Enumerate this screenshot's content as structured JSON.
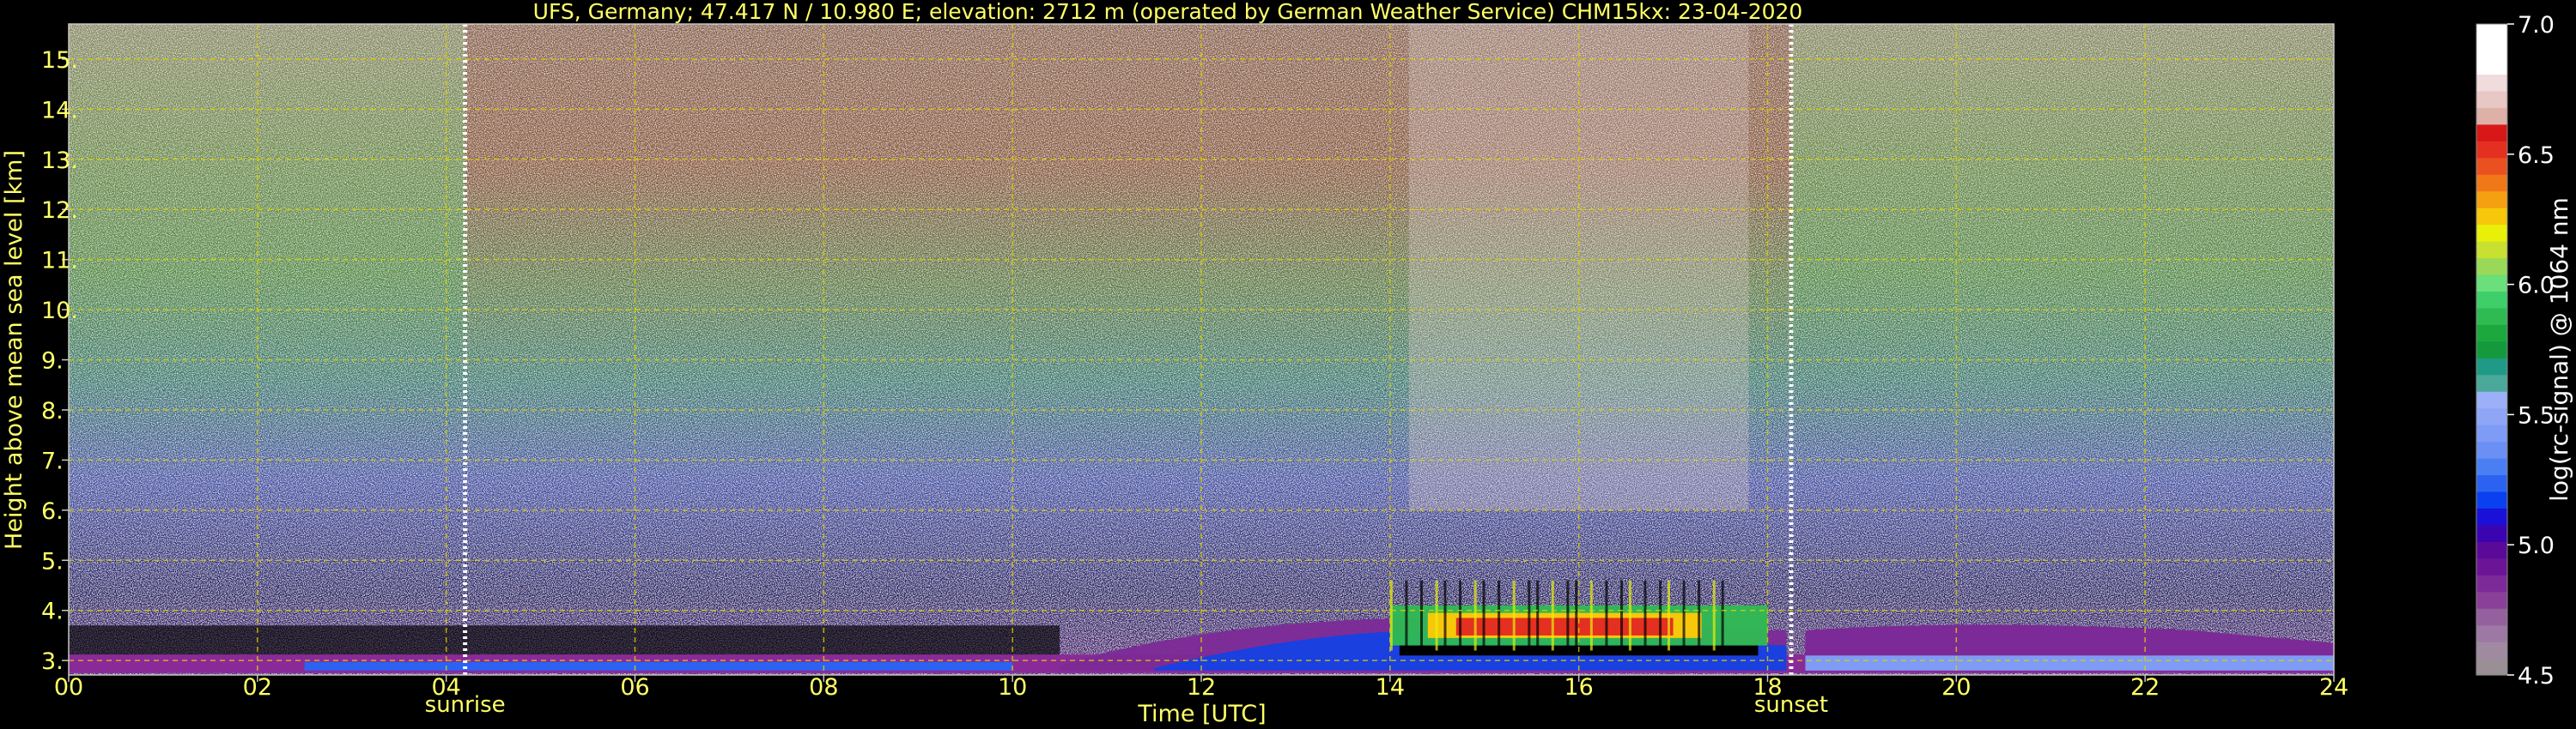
{
  "chart_data": {
    "type": "heatmap",
    "title": "UFS, Germany; 47.417 N / 10.980 E; elevation: 2712 m  (operated by German Weather Service)    CHM15kx: 23-04-2020",
    "xlabel": "Time [UTC]",
    "ylabel": "Height above mean sea level [km]",
    "xlim": [
      0,
      24
    ],
    "ylim": [
      2.712,
      15.7
    ],
    "x_ticks": [
      "00",
      "02",
      "04",
      "06",
      "08",
      "10",
      "12",
      "14",
      "16",
      "18",
      "20",
      "22",
      "24"
    ],
    "x_tick_values": [
      0,
      2,
      4,
      6,
      8,
      10,
      12,
      14,
      16,
      18,
      20,
      22,
      24
    ],
    "y_ticks": [
      "3.",
      "4.",
      "5.",
      "6.",
      "7.",
      "8.",
      "9.",
      "10.",
      "11.",
      "12.",
      "13.",
      "14.",
      "15."
    ],
    "y_tick_values": [
      3,
      4,
      5,
      6,
      7,
      8,
      9,
      10,
      11,
      12,
      13,
      14,
      15
    ],
    "grid": true,
    "markers": [
      {
        "label": "sunrise",
        "x": 4.2
      },
      {
        "label": "sunset",
        "x": 18.25
      }
    ],
    "colorbar": {
      "label": "log(rc-signal) @ 1064 nm",
      "range": [
        4.5,
        7.0
      ],
      "ticks": [
        "4.5",
        "5.0",
        "5.5",
        "6.0",
        "6.5",
        "7.0"
      ],
      "tick_values": [
        4.5,
        5.0,
        5.5,
        6.0,
        6.5,
        7.0
      ],
      "colors": [
        "#9a8f95",
        "#a08aa2",
        "#9d78a5",
        "#94609e",
        "#8a3f98",
        "#7c2a97",
        "#6c1496",
        "#5a0a98",
        "#3a04b0",
        "#1a10d8",
        "#0a40f0",
        "#2b62f2",
        "#4a7ff3",
        "#6a90f4",
        "#7e9cf6",
        "#8fa6f7",
        "#9bb0f8",
        "#4aa89a",
        "#1f9a86",
        "#149a3c",
        "#1da83e",
        "#2fbb52",
        "#3fcf6a",
        "#6adf7a",
        "#9ad958",
        "#c8e030",
        "#e8f00a",
        "#f7c80a",
        "#f5a010",
        "#f07818",
        "#eb5020",
        "#e43020",
        "#d81818",
        "#ddb0a8",
        "#e8c8c4",
        "#f0dcdc",
        "#ffffff",
        "#ffffff",
        "#ffffff"
      ]
    },
    "background_field": {
      "description_levels_km": [
        3,
        4,
        6,
        8,
        10,
        12,
        15.7
      ],
      "day_colors": [
        "#3a1a66",
        "#2a1a6a",
        "#3f4fa6",
        "#2f7a70",
        "#4f8a3a",
        "#8a5a30",
        "#8a6040"
      ],
      "night_colors": [
        "#3a1a66",
        "#2a1a6a",
        "#3f4fa6",
        "#2f7a70",
        "#4f8a3a",
        "#6a8a40",
        "#8a8a60"
      ]
    },
    "features": [
      {
        "name": "boundary layer",
        "x_range": [
          10.5,
          18.2
        ],
        "top_km": 3.85,
        "value": 5.0
      },
      {
        "name": "cloud layer",
        "x_range": [
          14.0,
          17.7
        ],
        "range_km": [
          3.3,
          4.1
        ],
        "value": 6.2
      },
      {
        "name": "evening layer",
        "x_range": [
          18.4,
          24.0
        ],
        "top_km": 3.75,
        "value": 4.8
      }
    ]
  },
  "colors": {
    "axis_text": "#ffff66",
    "grid": "#e0d000",
    "background": "#000000",
    "colorbar_text": "#ffffff"
  }
}
